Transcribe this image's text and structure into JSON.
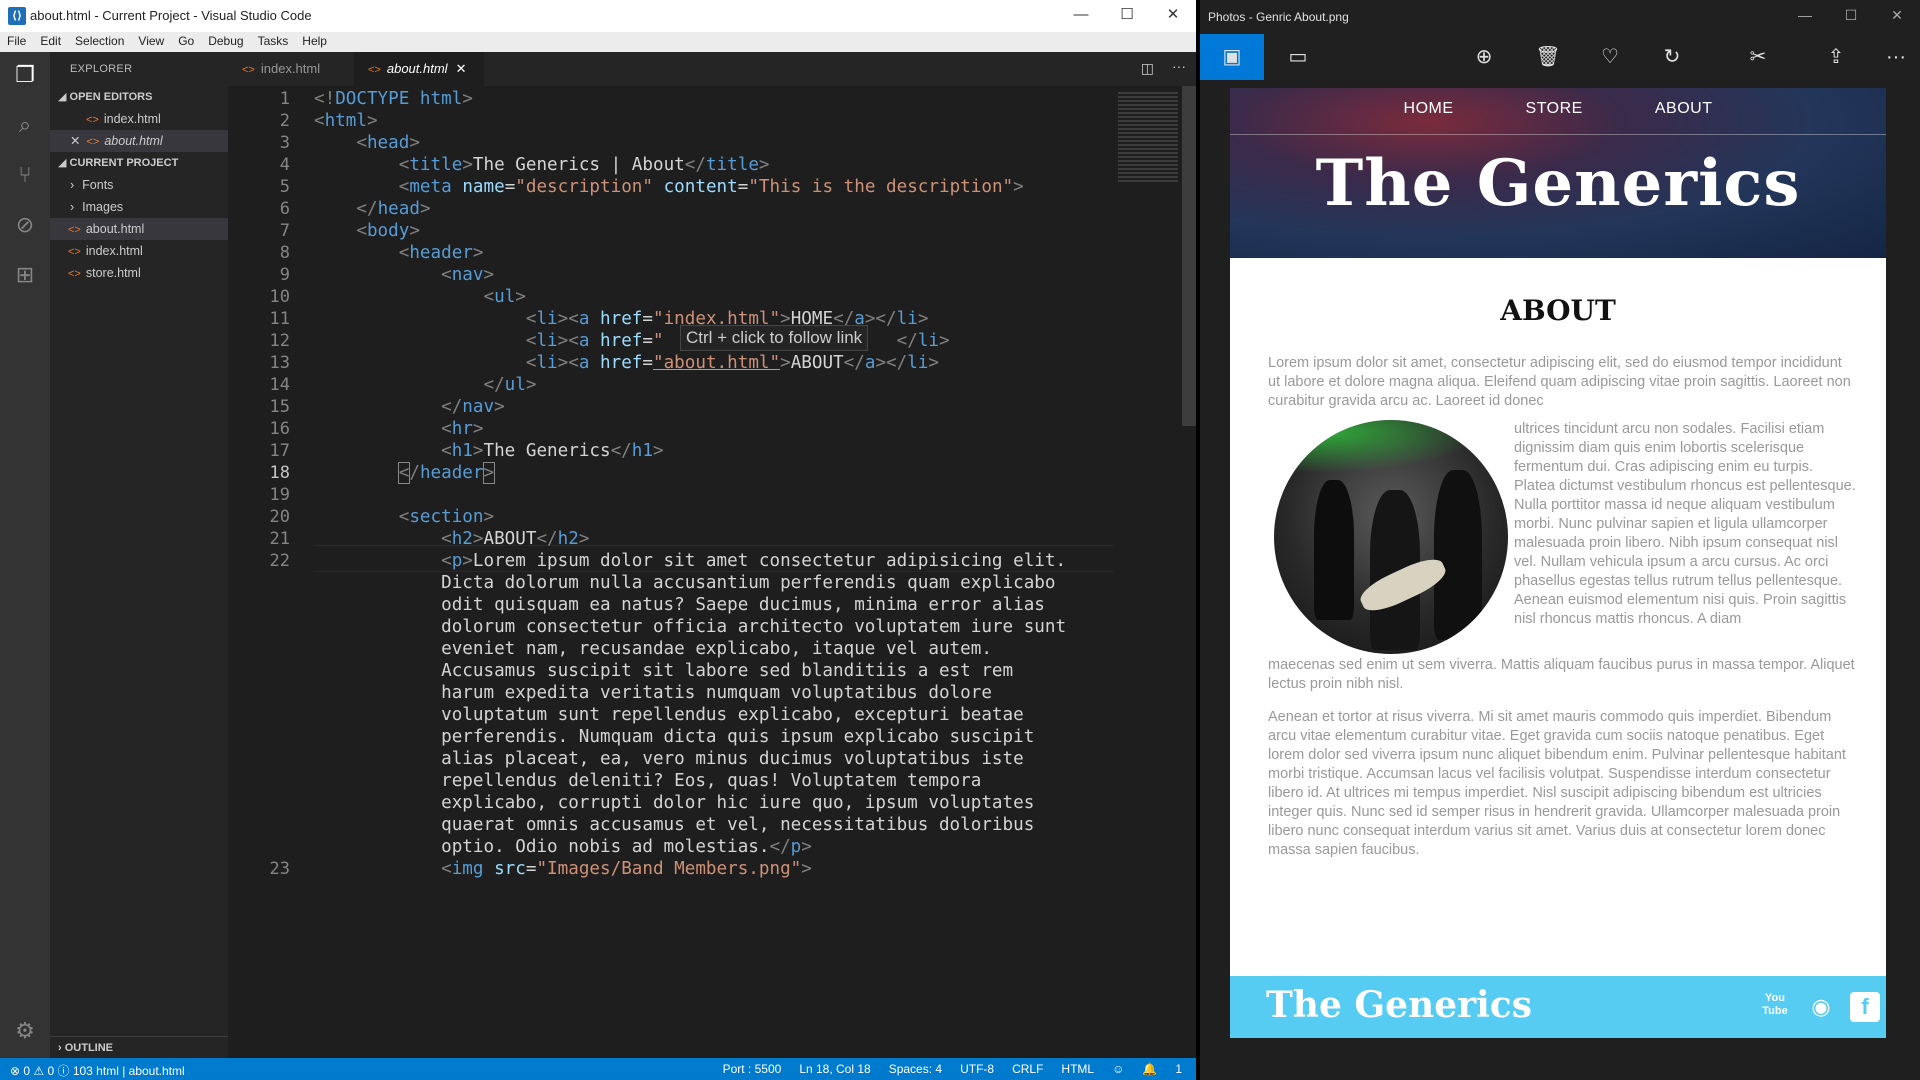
{
  "vscode": {
    "title": "about.html - Current Project - Visual Studio Code",
    "menu": [
      "File",
      "Edit",
      "Selection",
      "View",
      "Go",
      "Debug",
      "Tasks",
      "Help"
    ],
    "explorer": {
      "title": "EXPLORER",
      "open_editors_label": "OPEN EDITORS",
      "open_editors": [
        "index.html",
        "about.html"
      ],
      "project_label": "CURRENT PROJECT",
      "folders": [
        "Fonts",
        "Images"
      ],
      "files": [
        "about.html",
        "index.html",
        "store.html"
      ],
      "outline_label": "OUTLINE"
    },
    "tabs": [
      "index.html",
      "about.html"
    ],
    "line_numbers": [
      "1",
      "2",
      "3",
      "4",
      "5",
      "6",
      "7",
      "8",
      "9",
      "10",
      "11",
      "12",
      "13",
      "14",
      "15",
      "16",
      "17",
      "18",
      "19",
      "20",
      "21",
      "22",
      "23"
    ],
    "code": {
      "l1": "DOCTYPE html",
      "l4_title": "The Generics | About",
      "l5_name": "\"description\"",
      "l5_content": "\"This is the description\"",
      "l11_href": "\"index.html\"",
      "l11_text": "HOME",
      "l12_href": "\"",
      "l13_href": "\"about.html\"",
      "l13_text": "ABOUT",
      "l17_text": "The Generics",
      "l21_text": "ABOUT",
      "para": [
        "Lorem ipsum dolor sit amet consectetur adipisicing elit.",
        "Dicta dolorum nulla accusantium perferendis quam explicabo",
        "odit quisquam ea natus? Saepe ducimus, minima error alias",
        "dolorum consectetur officia architecto voluptatem iure sunt",
        "eveniet nam, recusandae explicabo, itaque vel autem.",
        "Accusamus suscipit sit labore sed blanditiis a est rem",
        "harum expedita veritatis numquam voluptatibus dolore",
        "voluptatum sunt repellendus explicabo, excepturi beatae",
        "perferendis. Numquam dicta quis ipsum explicabo suscipit",
        "alias placeat, ea, vero minus ducimus voluptatibus iste",
        "repellendus deleniti? Eos, quas! Voluptatem tempora",
        "explicabo, corrupti dolor hic iure quo, ipsum voluptates",
        "quaerat omnis accusamus et vel, necessitatibus doloribus",
        "optio. Odio nobis ad molestias."
      ],
      "l23_src": "\"Images/Band Members.png\""
    },
    "tooltip": "Ctrl + click to follow link",
    "status": {
      "left": "⊗ 0 ⚠ 0 ⓘ 103   html | about.html",
      "port": "Port : 5500",
      "pos": "Ln 18, Col 18",
      "spaces": "Spaces: 4",
      "enc": "UTF-8",
      "eol": "CRLF",
      "lang": "HTML",
      "bell": "1"
    }
  },
  "photos": {
    "title": "Photos - Genric About.png",
    "page": {
      "nav": [
        "HOME",
        "STORE",
        "ABOUT"
      ],
      "brand": "The Generics",
      "heading": "ABOUT",
      "p1_top": "Lorem ipsum dolor sit amet, consectetur adipiscing elit, sed do eiusmod tempor incididunt ut labore et dolore magna aliqua. Eleifend quam adipiscing vitae proin sagittis. Laoreet non curabitur gravida arcu ac. Laoreet id donec",
      "p1_side": "ultrices tincidunt arcu non sodales. Facilisi etiam dignissim diam quis enim lobortis scelerisque fermentum dui. Cras adipiscing enim eu turpis. Platea dictumst vestibulum rhoncus est pellentesque. Nulla porttitor massa id neque aliquam vestibulum morbi. Nunc pulvinar sapien et ligula ullamcorper malesuada proin libero. Nibh ipsum consequat nisl vel. Nullam vehicula ipsum a arcu cursus. Ac orci phasellus egestas tellus rutrum tellus pellentesque. Aenean euismod elementum nisi quis. Proin sagittis nisl rhoncus mattis rhoncus. A diam",
      "p1_bottom": "maecenas sed enim ut sem viverra. Mattis aliquam faucibus purus in massa tempor. Aliquet lectus proin nibh nisl.",
      "p2": "Aenean et tortor at risus viverra. Mi sit amet mauris commodo quis imperdiet. Bibendum arcu vitae elementum curabitur vitae. Eget gravida cum sociis natoque penatibus. Eget lorem dolor sed viverra ipsum nunc aliquet bibendum enim. Pulvinar pellentesque habitant morbi tristique. Accumsan lacus vel facilisis volutpat. Suspendisse interdum consectetur libero id. At ultrices mi tempus imperdiet. Nisl suscipit adipiscing bibendum est ultricies integer quis. Nunc sed id semper risus in hendrerit gravida. Ullamcorper malesuada proin libero nunc consequat interdum varius sit amet. Varius duis at consectetur lorem donec massa sapien faucibus.",
      "footer_brand": "The Generics",
      "footer_youtube": "You Tube"
    }
  }
}
